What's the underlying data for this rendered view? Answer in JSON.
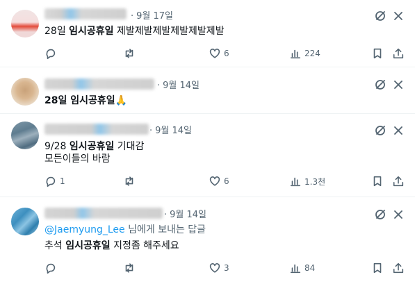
{
  "tweets": [
    {
      "time": "9월 17일",
      "lines": [
        {
          "pre": "28일 ",
          "bold": "임시공휴일",
          "post": " 제발제발제발제발제발제발"
        }
      ],
      "counts": {
        "reply": "",
        "retweet": "",
        "like": "6",
        "views": "224"
      }
    },
    {
      "time": "9월 14일",
      "lines": [
        {
          "pre": "",
          "bold": "28일 임시공휴일",
          "post": "🙏"
        }
      ],
      "counts": {
        "reply": "",
        "retweet": "",
        "like": "",
        "views": ""
      }
    },
    {
      "time": "9월 14일",
      "lines": [
        {
          "pre": "9/28 ",
          "bold": "임시공휴일",
          "post": " 기대감"
        },
        {
          "pre": "모든이들의 바람",
          "bold": "",
          "post": ""
        }
      ],
      "counts": {
        "reply": "1",
        "retweet": "",
        "like": "6",
        "views": "1.3천"
      }
    },
    {
      "time": "9월 14일",
      "mention": "@Jaemyung_Lee",
      "reply_suffix": " 님에게 보내는 답글",
      "lines": [
        {
          "pre": "추석 ",
          "bold": "임시공휴일",
          "post": " 지정좀 해주세요"
        }
      ],
      "counts": {
        "reply": "",
        "retweet": "",
        "like": "3",
        "views": "84"
      }
    }
  ],
  "icons": {
    "top": [
      "grok-icon",
      "more-icon"
    ],
    "actions": [
      "reply-icon",
      "retweet-icon",
      "like-icon",
      "views-icon",
      "bookmark-icon",
      "share-icon"
    ]
  },
  "colors": {
    "text": "#0f1419",
    "secondary": "#536471",
    "accent": "#1d9bf0",
    "border": "#eff3f4"
  }
}
